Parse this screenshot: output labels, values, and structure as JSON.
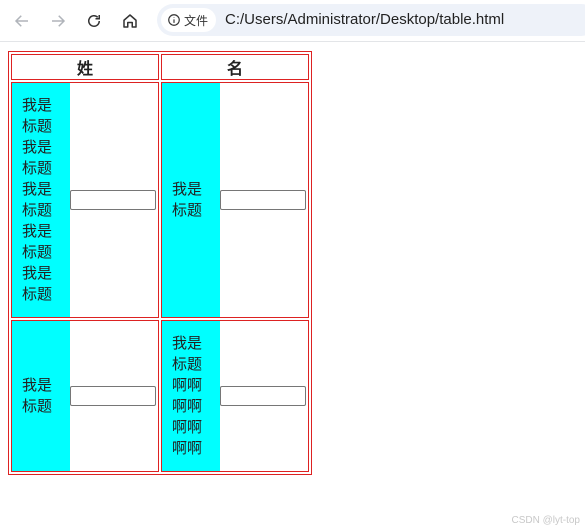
{
  "browser": {
    "back_icon": "arrow-left-icon",
    "forward_icon": "arrow-right-icon",
    "reload_icon": "reload-icon",
    "home_icon": "home-icon",
    "site_info_icon": "info-icon",
    "site_info_label": "文件",
    "url": "C:/Users/Administrator/Desktop/table.html"
  },
  "table": {
    "headers": [
      "姓",
      "名"
    ],
    "rows": [
      {
        "cells": [
          {
            "label": "我是\n标题\n我是\n标题\n我是\n标题\n我是\n标题\n我是\n标题",
            "input_value": ""
          },
          {
            "label": "我是\n标题",
            "input_value": ""
          }
        ]
      },
      {
        "cells": [
          {
            "label": "我是\n标题",
            "input_value": ""
          },
          {
            "label": "我是\n标题\n啊啊\n啊啊\n啊啊\n啊啊",
            "input_value": ""
          }
        ]
      }
    ],
    "label_background": "#00ffff",
    "border_color": "#dd2222"
  },
  "watermark": "CSDN @lyt-top"
}
